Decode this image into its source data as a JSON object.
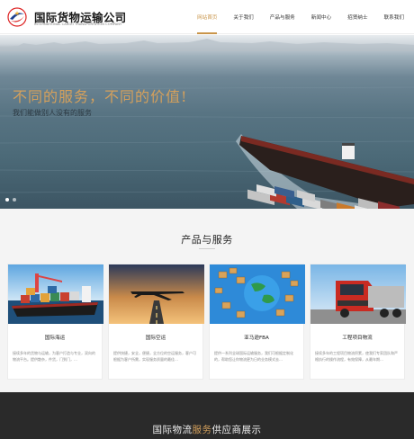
{
  "brand": {
    "name": "国际货物运输公司",
    "subtitle": "INTERNATIONAL CARGO TRANSPORTATION COMPANY"
  },
  "nav": {
    "items": [
      {
        "label": "网站首页",
        "active": true
      },
      {
        "label": "关于我们",
        "active": false
      },
      {
        "label": "产品与服务",
        "active": false
      },
      {
        "label": "新闻中心",
        "active": false
      },
      {
        "label": "招贤纳士",
        "active": false
      },
      {
        "label": "联系我们",
        "active": false
      }
    ]
  },
  "hero": {
    "headline": "不同的服务，不同的价值!",
    "tagline": "我们能做别人没有的服务",
    "slides": 2,
    "current": 1
  },
  "products": {
    "title": "产品与服务",
    "cards": [
      {
        "title": "国际海运",
        "desc": "接续多年的货物与运输，为客户打造与专业，双向的物流平台。提供散杂，件货，门到门，…"
      },
      {
        "title": "国际空运",
        "desc": "提供快捷，安全，便捷，全方位的空运服务，客户可根据为客户所需，实现服务质量的最佳…"
      },
      {
        "title": "亚马逊FBA",
        "desc": "提供一系列全球国际运输服务，我们可根据定制化的，帮助您让你物流更为日的业务模式去…"
      },
      {
        "title": "工程项目物流",
        "desc": "接续多年的工程项目物流积累，使我们专家团队和严格执行的操作流程，有效保障，从最年期…"
      }
    ]
  },
  "band": {
    "title_a": "国际物流",
    "title_hl": "服务",
    "title_b": "供应商展示"
  },
  "colors": {
    "accent": "#c9954a",
    "headline": "#d4a05c",
    "band_bg": "#2a2a2a"
  }
}
